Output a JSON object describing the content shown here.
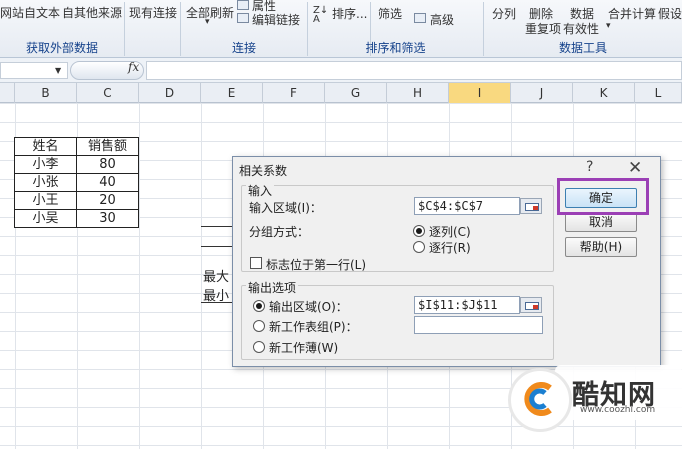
{
  "ribbon": {
    "items": [
      "网站",
      "自文本",
      "自其他来源",
      "现有连接",
      "全部刷新",
      "属性",
      "编辑链接",
      "排序...",
      "筛选",
      "高级",
      "分列",
      "删除",
      "数据",
      "合并计算",
      "假设",
      "重复项",
      "有效性"
    ],
    "groups": [
      "获取外部数据",
      "连接",
      "排序和筛选",
      "数据工具"
    ]
  },
  "formula_bar": {
    "fx": "fx",
    "namebox": "",
    "content": ""
  },
  "columns": [
    "B",
    "C",
    "D",
    "E",
    "F",
    "G",
    "H",
    "I",
    "J",
    "K",
    "L"
  ],
  "active_column": "I",
  "table": {
    "headers": [
      "姓名",
      "销售额"
    ],
    "rows": [
      [
        "小李",
        "80"
      ],
      [
        "小张",
        "40"
      ],
      [
        "小王",
        "20"
      ],
      [
        "小吴",
        "30"
      ]
    ]
  },
  "sheet_labels": [
    "最大",
    "最小"
  ],
  "dialog": {
    "title": "相关系数",
    "help": "?",
    "close": "✕",
    "input_section": "输入",
    "input_range_label": "输入区域(I)：",
    "input_range_value": "$C$4:$C$7",
    "grouping_label": "分组方式：",
    "by_column": "逐列(C)",
    "by_row": "逐行(R)",
    "labels_first_row": "标志位于第一行(L)",
    "output_section": "输出选项",
    "output_range_label": "输出区域(O)：",
    "output_range_value": "$I$11:$J$11",
    "new_sheet_label": "新工作表组(P)：",
    "new_sheet_value": "",
    "new_workbook_label": "新工作薄(W)",
    "ok": "确定",
    "cancel": "取消",
    "help_button": "帮助(H)"
  },
  "watermark": {
    "name": "酷知网",
    "url": "www.coozhi.com"
  }
}
